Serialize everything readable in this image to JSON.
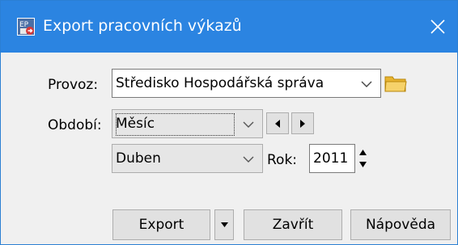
{
  "window": {
    "title": "Export pracovních výkazů",
    "icon": "export-timesheet-app-icon",
    "close_icon": "close-icon"
  },
  "form": {
    "provoz": {
      "label": "Provoz:",
      "value": "Středisko Hospodářská správa",
      "browse_icon": "folder-icon"
    },
    "obdobi": {
      "label": "Období:",
      "value": "Měsíc",
      "prev_icon": "triangle-left-icon",
      "next_icon": "triangle-right-icon"
    },
    "month": {
      "value": "Duben"
    },
    "rok": {
      "label": "Rok:",
      "value": "2011"
    }
  },
  "buttons": {
    "export": "Export",
    "zavrit": "Zavřít",
    "napoveda": "Nápověda"
  },
  "colors": {
    "titlebar": "#2b84e1",
    "window_bg": "#f0f0f0",
    "folder": "#f0c040"
  }
}
